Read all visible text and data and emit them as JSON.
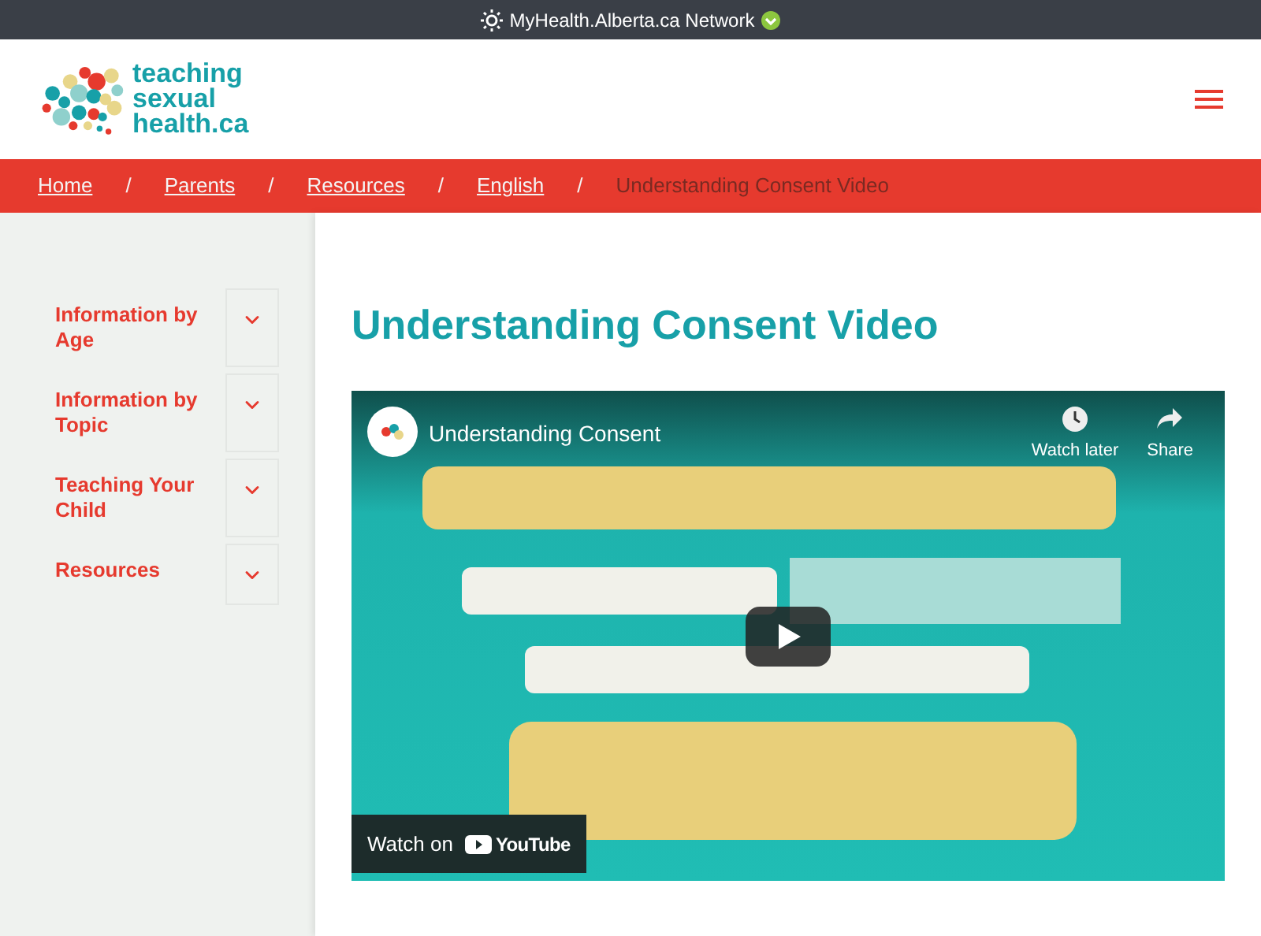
{
  "network_bar": {
    "label": "MyHealth.Alberta.ca Network"
  },
  "logo": {
    "lines": [
      "teaching",
      "sexual",
      "health.ca"
    ]
  },
  "breadcrumb": [
    {
      "label": "Home",
      "link": true
    },
    {
      "label": "Parents",
      "link": true
    },
    {
      "label": "Resources",
      "link": true
    },
    {
      "label": "English",
      "link": true
    },
    {
      "label": "Understanding Consent Video",
      "link": false
    }
  ],
  "breadcrumb_separator": "/",
  "sidebar": {
    "items": [
      {
        "label": "Information by Age",
        "expanded": false
      },
      {
        "label": "Information by Topic",
        "expanded": false
      },
      {
        "label": "Teaching Your Child",
        "expanded": false
      },
      {
        "label": "Resources",
        "expanded": false
      }
    ]
  },
  "page_title": "Understanding Consent Video",
  "video": {
    "title": "Understanding Consent",
    "actions": [
      "Watch later",
      "Share"
    ],
    "watch_on": "Watch on",
    "brand": "YouTube"
  }
}
